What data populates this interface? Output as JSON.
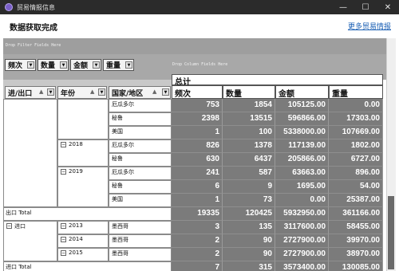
{
  "window": {
    "title": "贸易情报信息",
    "controls": {
      "minimize": "—",
      "maximize": "☐",
      "close": "✕"
    }
  },
  "header": {
    "title": "数据获取完成",
    "more_link": "更多贸易情报"
  },
  "drop_zones": {
    "filter": "Drop Filter Fields Here",
    "column": "Drop Column Fields Here"
  },
  "data_fields": [
    "频次",
    "数量",
    "金额",
    "重量"
  ],
  "row_fields": [
    "进/出口",
    "年份",
    "国家/地区"
  ],
  "grand_header": "总计",
  "measures": [
    "频次",
    "数量",
    "金额",
    "重量"
  ],
  "row_labels": {
    "export_group": "",
    "years": {
      "y2017": "",
      "y2018": "2018",
      "y2019": "2019",
      "y2013": "2013",
      "y2014": "2014",
      "y2015": "2015"
    },
    "countries": [
      "厄瓜多尔",
      "秘鲁",
      "美国",
      "厄瓜多尔",
      "秘鲁",
      "厄瓜多尔",
      "秘鲁",
      "美国",
      "墨西哥",
      "墨西哥",
      "墨西哥"
    ],
    "export_total": "出口 Total",
    "import_group": "进口",
    "import_total": "进口 Total"
  },
  "rows": [
    [
      "753",
      "1854",
      "105125.00",
      "0.00"
    ],
    [
      "2398",
      "13515",
      "596866.00",
      "17303.00"
    ],
    [
      "1",
      "100",
      "5338000.00",
      "107669.00"
    ],
    [
      "826",
      "1378",
      "117139.00",
      "1802.00"
    ],
    [
      "630",
      "6437",
      "205866.00",
      "6727.00"
    ],
    [
      "241",
      "587",
      "63663.00",
      "896.00"
    ],
    [
      "6",
      "9",
      "1695.00",
      "54.00"
    ],
    [
      "1",
      "73",
      "0.00",
      "25387.00"
    ],
    [
      "19335",
      "120425",
      "5932950.00",
      "361166.00"
    ],
    [
      "3",
      "135",
      "3117600.00",
      "58455.00"
    ],
    [
      "2",
      "90",
      "2727900.00",
      "39970.00"
    ],
    [
      "2",
      "90",
      "2727900.00",
      "38970.00"
    ],
    [
      "7",
      "315",
      "3573400.00",
      "130085.00"
    ]
  ],
  "colors": {
    "grid_bg": "#7b7b7b",
    "zone_bg": "#a8a8a8",
    "titlebar": "#2b2b2b",
    "link": "#1a5fb4"
  }
}
